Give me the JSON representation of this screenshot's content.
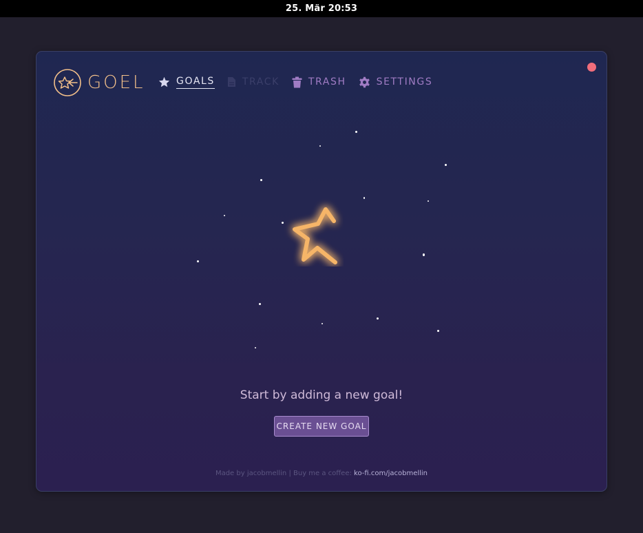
{
  "system_bar": {
    "datetime": "25. Mär  20:53"
  },
  "app": {
    "name": "GOEL"
  },
  "nav": {
    "items": [
      {
        "label": "GOALS",
        "icon": "star-icon",
        "state": "active"
      },
      {
        "label": "TRACK",
        "icon": "document-icon",
        "state": "disabled"
      },
      {
        "label": "TRASH",
        "icon": "trash-icon",
        "state": "normal"
      },
      {
        "label": "SETTINGS",
        "icon": "gear-icon",
        "state": "normal"
      }
    ]
  },
  "empty_state": {
    "message": "Start by adding a new goal!",
    "button_label": "CREATE NEW GOAL"
  },
  "footer": {
    "prefix": "Made by jacobmellin | Buy me a coffee: ",
    "link_text": "ko-fi.com/jacobmellin"
  },
  "colors": {
    "accent_orange": "#f3c08a",
    "close_dot": "#f06d7b",
    "button_bg": "#6a4f93",
    "nav_active": "#e6e6f4",
    "nav_muted": "#a07cc4"
  }
}
